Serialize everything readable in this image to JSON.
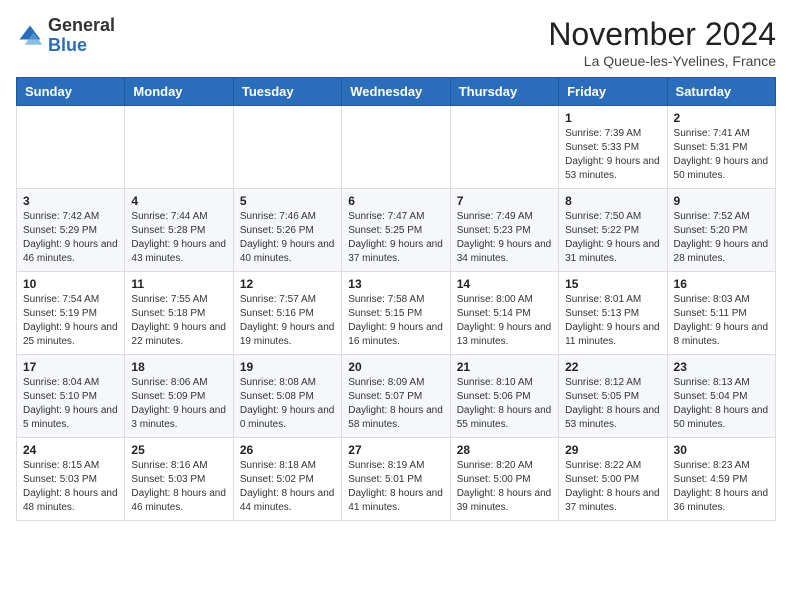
{
  "header": {
    "logo_line1": "General",
    "logo_line2": "Blue",
    "month": "November 2024",
    "location": "La Queue-les-Yvelines, France"
  },
  "weekdays": [
    "Sunday",
    "Monday",
    "Tuesday",
    "Wednesday",
    "Thursday",
    "Friday",
    "Saturday"
  ],
  "weeks": [
    [
      {
        "day": "",
        "sunrise": "",
        "sunset": "",
        "daylight": ""
      },
      {
        "day": "",
        "sunrise": "",
        "sunset": "",
        "daylight": ""
      },
      {
        "day": "",
        "sunrise": "",
        "sunset": "",
        "daylight": ""
      },
      {
        "day": "",
        "sunrise": "",
        "sunset": "",
        "daylight": ""
      },
      {
        "day": "",
        "sunrise": "",
        "sunset": "",
        "daylight": ""
      },
      {
        "day": "1",
        "sunrise": "Sunrise: 7:39 AM",
        "sunset": "Sunset: 5:33 PM",
        "daylight": "Daylight: 9 hours and 53 minutes."
      },
      {
        "day": "2",
        "sunrise": "Sunrise: 7:41 AM",
        "sunset": "Sunset: 5:31 PM",
        "daylight": "Daylight: 9 hours and 50 minutes."
      }
    ],
    [
      {
        "day": "3",
        "sunrise": "Sunrise: 7:42 AM",
        "sunset": "Sunset: 5:29 PM",
        "daylight": "Daylight: 9 hours and 46 minutes."
      },
      {
        "day": "4",
        "sunrise": "Sunrise: 7:44 AM",
        "sunset": "Sunset: 5:28 PM",
        "daylight": "Daylight: 9 hours and 43 minutes."
      },
      {
        "day": "5",
        "sunrise": "Sunrise: 7:46 AM",
        "sunset": "Sunset: 5:26 PM",
        "daylight": "Daylight: 9 hours and 40 minutes."
      },
      {
        "day": "6",
        "sunrise": "Sunrise: 7:47 AM",
        "sunset": "Sunset: 5:25 PM",
        "daylight": "Daylight: 9 hours and 37 minutes."
      },
      {
        "day": "7",
        "sunrise": "Sunrise: 7:49 AM",
        "sunset": "Sunset: 5:23 PM",
        "daylight": "Daylight: 9 hours and 34 minutes."
      },
      {
        "day": "8",
        "sunrise": "Sunrise: 7:50 AM",
        "sunset": "Sunset: 5:22 PM",
        "daylight": "Daylight: 9 hours and 31 minutes."
      },
      {
        "day": "9",
        "sunrise": "Sunrise: 7:52 AM",
        "sunset": "Sunset: 5:20 PM",
        "daylight": "Daylight: 9 hours and 28 minutes."
      }
    ],
    [
      {
        "day": "10",
        "sunrise": "Sunrise: 7:54 AM",
        "sunset": "Sunset: 5:19 PM",
        "daylight": "Daylight: 9 hours and 25 minutes."
      },
      {
        "day": "11",
        "sunrise": "Sunrise: 7:55 AM",
        "sunset": "Sunset: 5:18 PM",
        "daylight": "Daylight: 9 hours and 22 minutes."
      },
      {
        "day": "12",
        "sunrise": "Sunrise: 7:57 AM",
        "sunset": "Sunset: 5:16 PM",
        "daylight": "Daylight: 9 hours and 19 minutes."
      },
      {
        "day": "13",
        "sunrise": "Sunrise: 7:58 AM",
        "sunset": "Sunset: 5:15 PM",
        "daylight": "Daylight: 9 hours and 16 minutes."
      },
      {
        "day": "14",
        "sunrise": "Sunrise: 8:00 AM",
        "sunset": "Sunset: 5:14 PM",
        "daylight": "Daylight: 9 hours and 13 minutes."
      },
      {
        "day": "15",
        "sunrise": "Sunrise: 8:01 AM",
        "sunset": "Sunset: 5:13 PM",
        "daylight": "Daylight: 9 hours and 11 minutes."
      },
      {
        "day": "16",
        "sunrise": "Sunrise: 8:03 AM",
        "sunset": "Sunset: 5:11 PM",
        "daylight": "Daylight: 9 hours and 8 minutes."
      }
    ],
    [
      {
        "day": "17",
        "sunrise": "Sunrise: 8:04 AM",
        "sunset": "Sunset: 5:10 PM",
        "daylight": "Daylight: 9 hours and 5 minutes."
      },
      {
        "day": "18",
        "sunrise": "Sunrise: 8:06 AM",
        "sunset": "Sunset: 5:09 PM",
        "daylight": "Daylight: 9 hours and 3 minutes."
      },
      {
        "day": "19",
        "sunrise": "Sunrise: 8:08 AM",
        "sunset": "Sunset: 5:08 PM",
        "daylight": "Daylight: 9 hours and 0 minutes."
      },
      {
        "day": "20",
        "sunrise": "Sunrise: 8:09 AM",
        "sunset": "Sunset: 5:07 PM",
        "daylight": "Daylight: 8 hours and 58 minutes."
      },
      {
        "day": "21",
        "sunrise": "Sunrise: 8:10 AM",
        "sunset": "Sunset: 5:06 PM",
        "daylight": "Daylight: 8 hours and 55 minutes."
      },
      {
        "day": "22",
        "sunrise": "Sunrise: 8:12 AM",
        "sunset": "Sunset: 5:05 PM",
        "daylight": "Daylight: 8 hours and 53 minutes."
      },
      {
        "day": "23",
        "sunrise": "Sunrise: 8:13 AM",
        "sunset": "Sunset: 5:04 PM",
        "daylight": "Daylight: 8 hours and 50 minutes."
      }
    ],
    [
      {
        "day": "24",
        "sunrise": "Sunrise: 8:15 AM",
        "sunset": "Sunset: 5:03 PM",
        "daylight": "Daylight: 8 hours and 48 minutes."
      },
      {
        "day": "25",
        "sunrise": "Sunrise: 8:16 AM",
        "sunset": "Sunset: 5:03 PM",
        "daylight": "Daylight: 8 hours and 46 minutes."
      },
      {
        "day": "26",
        "sunrise": "Sunrise: 8:18 AM",
        "sunset": "Sunset: 5:02 PM",
        "daylight": "Daylight: 8 hours and 44 minutes."
      },
      {
        "day": "27",
        "sunrise": "Sunrise: 8:19 AM",
        "sunset": "Sunset: 5:01 PM",
        "daylight": "Daylight: 8 hours and 41 minutes."
      },
      {
        "day": "28",
        "sunrise": "Sunrise: 8:20 AM",
        "sunset": "Sunset: 5:00 PM",
        "daylight": "Daylight: 8 hours and 39 minutes."
      },
      {
        "day": "29",
        "sunrise": "Sunrise: 8:22 AM",
        "sunset": "Sunset: 5:00 PM",
        "daylight": "Daylight: 8 hours and 37 minutes."
      },
      {
        "day": "30",
        "sunrise": "Sunrise: 8:23 AM",
        "sunset": "Sunset: 4:59 PM",
        "daylight": "Daylight: 8 hours and 36 minutes."
      }
    ]
  ]
}
